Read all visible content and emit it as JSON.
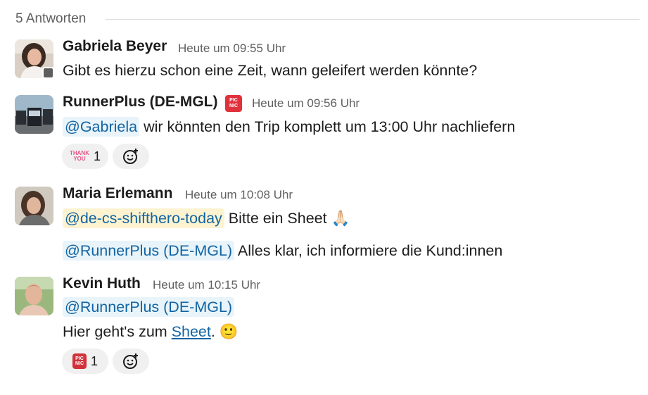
{
  "thread": {
    "reply_count": "5 Antworten"
  },
  "messages": [
    {
      "author": "Gabriela Beyer",
      "time": "Heute um 09:55 Uhr",
      "text": "Gibt es hierzu schon eine Zeit, wann geleifert werden könnte?"
    },
    {
      "author": "RunnerPlus (DE-MGL)",
      "badge": "PIC NIC",
      "time": "Heute um 09:56 Uhr",
      "mention": "@Gabriela",
      "text": " wir könnten den Trip komplett um 13:00 Uhr nachliefern",
      "reaction": {
        "emoji": "THANK YOU",
        "count": "1"
      }
    },
    {
      "author": "Maria Erlemann",
      "time": "Heute um 10:08 Uhr",
      "mention": "@de-cs-shifthero-today",
      "text": " Bitte ein Sheet",
      "emoji": "🙏🏻",
      "mention2": "@RunnerPlus (DE-MGL)",
      "text2": " Alles klar, ich informiere die Kund:innen"
    },
    {
      "author": "Kevin Huth",
      "time": "Heute um 10:15 Uhr",
      "mention": "@RunnerPlus (DE-MGL)",
      "text_before_link": "Hier geht's zum ",
      "link": "Sheet",
      "text_after_link": ". ",
      "emoji": "🙂",
      "reaction": {
        "emoji": "PIC NIC",
        "count": "1"
      }
    }
  ],
  "colors": {
    "accent": "#1264a3",
    "mention_bg": "#e8f4fa",
    "usergroup_bg": "#fdf3d0",
    "muted": "#616061"
  }
}
